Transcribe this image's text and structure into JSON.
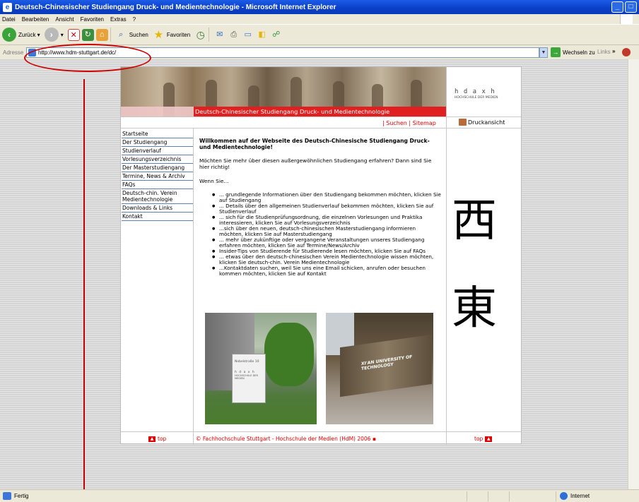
{
  "window": {
    "title": "Deutsch-Chinesischer Studiengang Druck- und Medientechnologie - Microsoft Internet Explorer"
  },
  "menu": [
    "Datei",
    "Bearbeiten",
    "Ansicht",
    "Favoriten",
    "Extras",
    "?"
  ],
  "toolbar": {
    "back": "Zurück",
    "search": "Suchen",
    "favorites": "Favoriten"
  },
  "address": {
    "label": "Adresse",
    "url": "http://www.hdm-stuttgart.de/dc/",
    "go": "Wechseln zu",
    "links": "Links"
  },
  "page": {
    "banner_title": "Deutsch-Chinesischer Studiengang Druck- und Medientechnologie",
    "logo_marks": "h d a x h",
    "logo_sub": "HOCHSCHULE DER MEDIEN",
    "top_search": "Suchen",
    "top_sitemap": "Sitemap",
    "print_view": "Druckansicht",
    "nav": [
      "Startseite",
      "Der Studiengang",
      "Studienverlauf",
      "Vorlesungsverzeichnis",
      "Der Masterstudiengang",
      "Termine, News & Archiv",
      "FAQs",
      "Deutsch-chin. Verein Medientechnologie",
      "Downloads & Links",
      "Kontakt"
    ],
    "heading": "Willkommen auf der Webseite des Deutsch-Chinesische Studiengang Druck- und Medientechnologie!",
    "intro": "Möchten Sie mehr über diesen außergewöhnlichen Studiengang erfahren? Dann sind Sie hier richtig!",
    "wenn": "Wenn Sie...",
    "bullets": [
      "... grundlegende Informationen über den Studiengang bekommen möchten, klicken Sie auf Studiengang",
      "... Details über den allgemeinen Studienverlauf bekommen möchten, klicken Sie auf Studienverlauf",
      "... sich für die Studienprüfungsordnung, die einzelnen Vorlesungen und Praktika interessieren, klicken Sie auf Vorlesungsverzeichnis",
      "...sich über den neuen, deutsch-chinesischen Masterstudiengang informieren möchten, klicken Sie auf Masterstudiengang",
      "... mehr über zukünftige oder vergangene Veranstaltungen unseres Studiengang erfahren möchten, klicken Sie auf Termine/News/Archiv",
      "Insider-Tips von Studierende für Studierende lesen möchten, klicken Sie auf FAQs",
      "... etwas über den deutsch-chinesischen Verein Medientechnologie wissen möchten, klicken Sie deutsch-chin. Verein Medientechnologie",
      "...Kontaktdaten suchen, weil Sie uns eine Email schicken, anrufen oder besuchen kommen möchten, klicken Sie auf Kontakt"
    ],
    "photo1_sign": "Nobelstraße 10",
    "photo1_logo": "h d a x h",
    "photo1_logo_sub": "HOCHSCHULE DER MEDIEN",
    "photo2_sign": "XI'AN UNIVERSITY OF TECHNOLOGY",
    "hanzi": [
      "西",
      "東"
    ],
    "top_link": "top",
    "footer": "© Fachhochschule Stuttgart - Hochschule der Medien (HdM) 2006 ▪"
  },
  "status": {
    "left": "Fertig",
    "zone": "Internet"
  }
}
